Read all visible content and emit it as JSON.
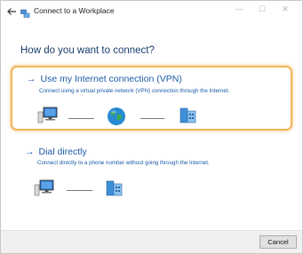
{
  "window": {
    "title": "Connect to a Workplace",
    "controls": {
      "minimize": "—",
      "maximize": "☐",
      "close": "✕"
    }
  },
  "page": {
    "heading": "How do you want to connect?"
  },
  "options": [
    {
      "title": "Use my Internet connection (VPN)",
      "description": "Connect using a virtual private network (VPN) connection through the Internet.",
      "highlighted": true
    },
    {
      "title": "Dial directly",
      "description": "Connect directly to a phone number without going through the Internet.",
      "highlighted": false
    }
  ],
  "footer": {
    "cancel_label": "Cancel"
  },
  "icons": {
    "back": "back-arrow-icon",
    "app": "network-icon",
    "computer": "computer-icon",
    "globe": "globe-icon",
    "workplace": "workplace-building-icon"
  },
  "colors": {
    "heading": "#1a3e6e",
    "link": "#1c5aa8",
    "highlight_border": "#f2b55a",
    "footer_bg": "#f0f0f0"
  }
}
